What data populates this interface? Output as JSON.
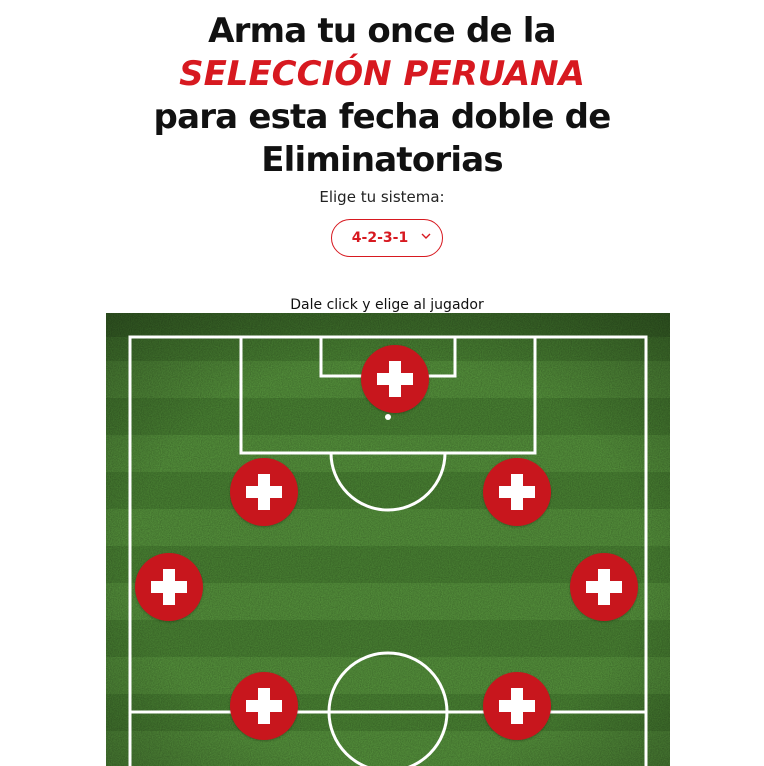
{
  "header": {
    "line1": "Arma tu once de la",
    "line2": "SELECCIÓN PERUANA",
    "line3": "para esta fecha doble de",
    "line4": "Eliminatorias",
    "accent_color": "#d71920"
  },
  "system": {
    "label": "Elige tu sistema:",
    "selected": "4-2-3-1",
    "dropdown_icon": "chevron-down-icon"
  },
  "field": {
    "hint": "Dale click y elige al jugador",
    "grass_color": "#4e8a36",
    "line_color": "#ffffff",
    "slot_color": "#c8161d",
    "slot_icon": "plus-icon",
    "visible_slot_count": 7
  }
}
